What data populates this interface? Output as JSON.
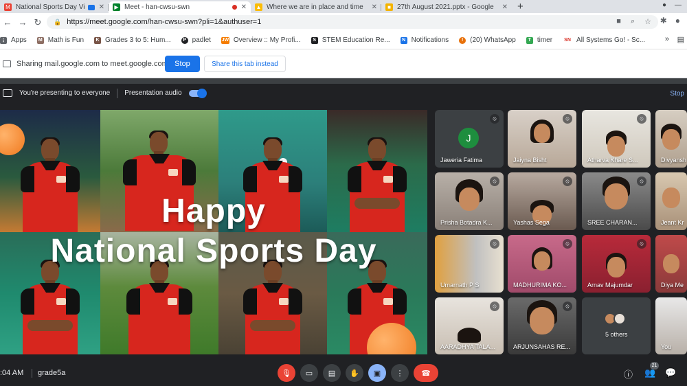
{
  "browser": {
    "tabs": [
      {
        "label": "National Sports Day Video -",
        "fav_color": "#ea4335",
        "fav_glyph": "M"
      },
      {
        "label": "Meet - han-cwsu-swn",
        "fav_color": "#00832d",
        "fav_glyph": "▶"
      },
      {
        "label": "Where we are in place and time",
        "fav_color": "#fbbc04",
        "fav_glyph": "▲"
      },
      {
        "label": "27th August 2021.pptx - Google",
        "fav_color": "#f4b400",
        "fav_glyph": "■"
      }
    ],
    "url": "https://meet.google.com/han-cwsu-swn?pli=1&authuser=1",
    "bookmarks": [
      {
        "label": "Apps",
        "color": "#5f6368",
        "glyph": "⋮"
      },
      {
        "label": "Math is Fun",
        "color": "#8d6e63",
        "glyph": "M"
      },
      {
        "label": "Grades 3 to 5: Hum...",
        "color": "#795548",
        "glyph": "K"
      },
      {
        "label": "padlet",
        "color": "#202124",
        "glyph": "P"
      },
      {
        "label": "Overview :: My Profi...",
        "color": "#f57c00",
        "glyph": "JW"
      },
      {
        "label": "STEM Education Re...",
        "color": "#202124",
        "glyph": "S"
      },
      {
        "label": "Notifications",
        "color": "#1a73e8",
        "glyph": "N"
      },
      {
        "label": "(20) WhatsApp",
        "color": "#e8710a",
        "glyph": "!"
      },
      {
        "label": "timer",
        "color": "#34a853",
        "glyph": "T"
      },
      {
        "label": "All Systems Go! - Sc...",
        "color": "#d93025",
        "glyph": "SN"
      }
    ]
  },
  "share_banner": {
    "text": "Sharing mail.google.com to meet.google.com",
    "stop_label": "Stop",
    "share_tab_label": "Share this tab instead"
  },
  "presenting": {
    "text": "You're presenting to everyone",
    "audio_label": "Presentation audio",
    "stop_label": "Stop"
  },
  "slide": {
    "line1": "Happy",
    "line2": "National Sports Day"
  },
  "participants": [
    {
      "name": "Jaweria Fatima"
    },
    {
      "name": "Jaiyna Bisht"
    },
    {
      "name": "Atharva Khare S..."
    },
    {
      "name": "Divyansh"
    },
    {
      "name": "Prisha Botadra K..."
    },
    {
      "name": "Yashas Sega"
    },
    {
      "name": "SREE CHARAN..."
    },
    {
      "name": "Jeant Kr"
    },
    {
      "name": "Umarnath P S"
    },
    {
      "name": "MADHURIMA KO..."
    },
    {
      "name": "Arnav Majumdar"
    },
    {
      "name": "Diya Me"
    },
    {
      "name": "AARADHYA TALA..."
    },
    {
      "name": "ARJUNSAHAS RE..."
    },
    {
      "name": "5 others"
    },
    {
      "name": "You"
    }
  ],
  "avatar_initial": "J",
  "footer": {
    "time": ":04 AM",
    "meeting": "grade5a",
    "people_count": "21"
  }
}
